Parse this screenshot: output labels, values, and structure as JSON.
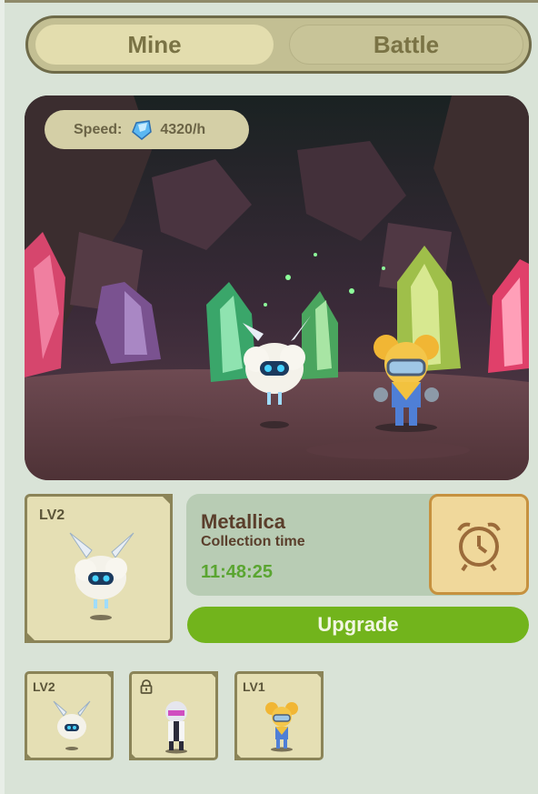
{
  "tabs": {
    "mine": "Mine",
    "battle": "Battle",
    "active": "Mine"
  },
  "speed": {
    "label": "Speed:",
    "value": "4320/h",
    "icon": "diamond-gem-icon"
  },
  "selected": {
    "level": "LV2",
    "name": "Metallica",
    "collection_label": "Collection time",
    "collection_time": "11:48:25"
  },
  "actions": {
    "upgrade": "Upgrade",
    "clock_icon": "alarm-clock-icon"
  },
  "slots": [
    {
      "level": "LV2",
      "character": "cloud-robot",
      "locked": false
    },
    {
      "level": "",
      "character": "scientist",
      "locked": true,
      "lock_icon": "lock-icon"
    },
    {
      "level": "LV1",
      "character": "goggles-girl",
      "locked": false
    }
  ],
  "colors": {
    "background": "#d9e3d7",
    "accent_green": "#72b41c",
    "time_green": "#5aa531",
    "name_brown": "#5a3e2b"
  }
}
